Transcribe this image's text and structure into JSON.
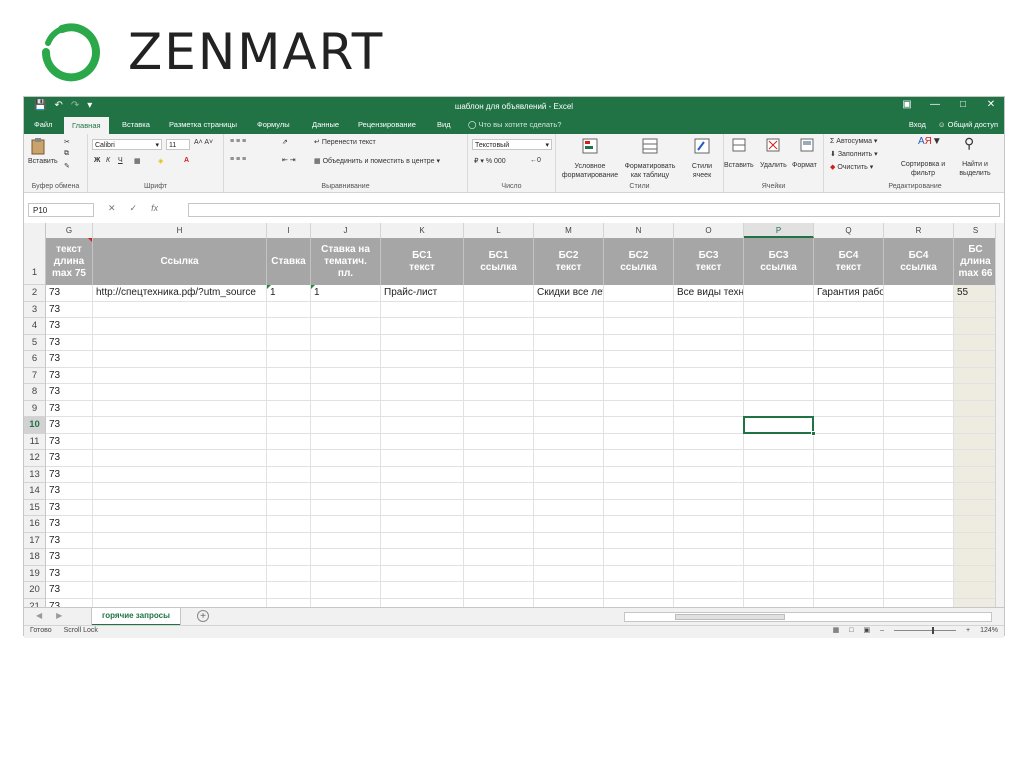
{
  "brand": {
    "name": "ZENMART"
  },
  "window": {
    "title": "шаблон для объявлений - Excel",
    "qat": [
      "save-icon",
      "undo-icon",
      "redo-icon",
      "customize-icon"
    ]
  },
  "tabs": {
    "items": [
      "Файл",
      "Главная",
      "Вставка",
      "Разметка страницы",
      "Формулы",
      "Данные",
      "Рецензирование",
      "Вид"
    ],
    "tell_me": "Что вы хотите сделать?",
    "signin": "Вход",
    "share": "Общий доступ"
  },
  "ribbon": {
    "clipboard": {
      "paste": "Вставить",
      "label": "Буфер обмена"
    },
    "font": {
      "name": "Calibri",
      "size": "11",
      "label": "Шрифт"
    },
    "alignment": {
      "wrap": "Перенести текст",
      "merge": "Объединить и поместить в центре",
      "label": "Выравнивание"
    },
    "number": {
      "format": "Текстовый",
      "label": "Число"
    },
    "styles": {
      "conditional": "Условное форматирование",
      "as_table": "Форматировать как таблицу",
      "cell_styles": "Стили ячеек",
      "label": "Стили"
    },
    "cells": {
      "insert": "Вставить",
      "delete": "Удалить",
      "format": "Формат",
      "label": "Ячейки"
    },
    "editing": {
      "autosum": "Автосумма",
      "fill": "Заполнить",
      "clear": "Очистить",
      "sort": "Сортировка и фильтр",
      "find": "Найти и выделить",
      "label": "Редактирование"
    }
  },
  "formula_bar": {
    "name_box": "P10",
    "value": ""
  },
  "columns": [
    "G",
    "H",
    "I",
    "J",
    "K",
    "L",
    "M",
    "N",
    "O",
    "P",
    "Q",
    "R",
    "S"
  ],
  "selected_column": "P",
  "headers": [
    "текст\nдлина\nmax 75",
    "Ссылка",
    "Ставка",
    "Ставка на\nтематич.\nпл.",
    "БС1\nтекст",
    "БС1\nссылка",
    "БС2\nтекст",
    "БС2\nссылка",
    "БС3\nтекст",
    "БС3\nссылка",
    "БС4\nтекст",
    "БС4\nссылка",
    "БС\nдлина\nmax 66"
  ],
  "row2": [
    "73",
    "http://спецтехника.рф/?utm_source",
    "1",
    "1",
    "Прайс-лист",
    "",
    "Скидки все лето",
    "",
    "Все виды техники",
    "",
    "Гарантия работ",
    "",
    "55"
  ],
  "rows": [
    {
      "num": "1"
    },
    {
      "num": "2"
    },
    {
      "num": "3",
      "g": "73"
    },
    {
      "num": "4",
      "g": "73"
    },
    {
      "num": "5",
      "g": "73"
    },
    {
      "num": "6",
      "g": "73"
    },
    {
      "num": "7",
      "g": "73"
    },
    {
      "num": "8",
      "g": "73"
    },
    {
      "num": "9",
      "g": "73"
    },
    {
      "num": "10",
      "g": "73"
    },
    {
      "num": "11",
      "g": "73"
    },
    {
      "num": "12",
      "g": "73"
    },
    {
      "num": "13",
      "g": "73"
    },
    {
      "num": "14",
      "g": "73"
    },
    {
      "num": "15",
      "g": "73"
    },
    {
      "num": "16",
      "g": "73"
    },
    {
      "num": "17",
      "g": "73"
    },
    {
      "num": "18",
      "g": "73"
    },
    {
      "num": "19",
      "g": "73"
    },
    {
      "num": "20",
      "g": "73"
    },
    {
      "num": "21",
      "g": "73"
    }
  ],
  "selected_row": "10",
  "sheet": {
    "active": "горячие запросы"
  },
  "status": {
    "ready": "Готово",
    "scroll_lock": "Scroll Lock",
    "zoom": "124%"
  },
  "colors": {
    "excel_green": "#217346",
    "header_gray": "#a6a6a6",
    "shaded": "#eeece1"
  }
}
